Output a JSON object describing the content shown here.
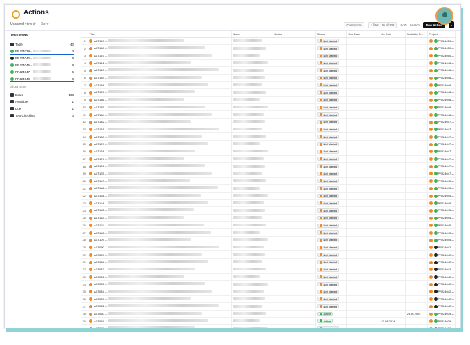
{
  "header": {
    "title": "Actions",
    "view_label": "Unsaved view ⊙",
    "save_label": "Save"
  },
  "toolbar": {
    "customize": "Customize",
    "filter": "1 filter | 40 of 138",
    "sort": "Sort",
    "search": "Search",
    "new_action": "New Action",
    "dropdown": "⌄"
  },
  "sidebar": {
    "heading": "Team views",
    "table": {
      "label": "Table",
      "count": "40"
    },
    "projects": [
      {
        "label": "PRJ24039 -",
        "count": "3",
        "color": "#3fb25a"
      },
      {
        "label": "PRJ24042 -",
        "count": "9",
        "color": "#222222"
      },
      {
        "label": "PRJ24045 -",
        "count": "9",
        "color": "#3fb25a"
      },
      {
        "label": "PRJ24047 -",
        "count": "6",
        "color": "#3fb25a"
      },
      {
        "label": "PRJ24048 -",
        "count": "8",
        "color": "#3fb25a"
      }
    ],
    "show_more": "Show more",
    "views": [
      {
        "label": "Board",
        "count": "138"
      },
      {
        "label": "Available",
        "count": "1"
      },
      {
        "label": "Due",
        "count": "1"
      },
      {
        "label": "Text Checklist",
        "count": "0"
      }
    ]
  },
  "columns": {
    "title": "Title",
    "name": "Name",
    "notes": "Notes",
    "status": "Status",
    "due": "Due Date",
    "do": "Do Date",
    "available": "Available Fr...",
    "project": "Project"
  },
  "rows": [
    {
      "n": "1",
      "id": "ACT159 -/-",
      "status": "Not started",
      "do": "",
      "avail": "",
      "project": "PRJ24050 -/-",
      "pc": "#3fb25a"
    },
    {
      "n": "2",
      "id": "ACT158 -/-",
      "status": "Not started",
      "do": "",
      "avail": "",
      "project": "PRJ24050 -/-",
      "pc": "#3fb25a"
    },
    {
      "n": "3",
      "id": "ACT157 -/-",
      "status": "Not started",
      "do": "",
      "avail": "",
      "project": "PRJ24050 -/-",
      "pc": "#3fb25a"
    },
    {
      "n": "4",
      "id": "ACT141 -/-",
      "status": "Not started",
      "do": "",
      "avail": "",
      "project": "PRJ24048 -/-",
      "pc": "#3fb25a"
    },
    {
      "n": "5",
      "id": "ACT140 -/-",
      "status": "Not started",
      "do": "",
      "avail": "",
      "project": "PRJ24048 -/-",
      "pc": "#3fb25a"
    },
    {
      "n": "6",
      "id": "ACT139 -/-",
      "status": "Not started",
      "do": "",
      "avail": "",
      "project": "PRJ24048 -/-",
      "pc": "#3fb25a"
    },
    {
      "n": "7",
      "id": "ACT138 -/-",
      "status": "Not started",
      "do": "",
      "avail": "",
      "project": "PRJ24048 -/-",
      "pc": "#3fb25a"
    },
    {
      "n": "8",
      "id": "ACT137 -/-",
      "status": "Not started",
      "do": "",
      "avail": "",
      "project": "PRJ24048 -/-",
      "pc": "#3fb25a"
    },
    {
      "n": "9",
      "id": "ACT136 -/-",
      "status": "Not started",
      "do": "",
      "avail": "",
      "project": "PRJ24048 -/-",
      "pc": "#3fb25a"
    },
    {
      "n": "10",
      "id": "ACT135 -/-",
      "status": "Not started",
      "do": "",
      "avail": "",
      "project": "PRJ24048 -/-",
      "pc": "#3fb25a"
    },
    {
      "n": "11",
      "id": "ACT134 -/-",
      "status": "Not started",
      "do": "",
      "avail": "",
      "project": "PRJ24048 -/-",
      "pc": "#3fb25a"
    },
    {
      "n": "12",
      "id": "ACT132 -/-",
      "status": "Not started",
      "do": "",
      "avail": "",
      "project": "PRJ24047 -/-",
      "pc": "#3fb25a"
    },
    {
      "n": "13",
      "id": "ACT131 -/-",
      "status": "Not started",
      "do": "",
      "avail": "",
      "project": "PRJ24047 -/-",
      "pc": "#3fb25a"
    },
    {
      "n": "14",
      "id": "ACT130 -/-",
      "status": "Not started",
      "do": "",
      "avail": "",
      "project": "PRJ24047 -/-",
      "pc": "#3fb25a"
    },
    {
      "n": "15",
      "id": "ACT129 -/-",
      "status": "Not started",
      "do": "",
      "avail": "",
      "project": "PRJ24047 -/-",
      "pc": "#3fb25a"
    },
    {
      "n": "16",
      "id": "ACT128 -/-",
      "status": "Not started",
      "do": "",
      "avail": "",
      "project": "PRJ24047 -/-",
      "pc": "#3fb25a"
    },
    {
      "n": "17",
      "id": "ACT127 -/-",
      "status": "Not started",
      "do": "",
      "avail": "",
      "project": "PRJ24047 -/-",
      "pc": "#3fb25a"
    },
    {
      "n": "18",
      "id": "ACT126 -/-",
      "status": "Not started",
      "do": "",
      "avail": "",
      "project": "PRJ24047 -/-",
      "pc": "#3fb25a"
    },
    {
      "n": "19",
      "id": "ACT125 -/-",
      "status": "Not started",
      "do": "",
      "avail": "",
      "project": "PRJ24047 -/-",
      "pc": "#3fb25a"
    },
    {
      "n": "20",
      "id": "ACT117 -/-",
      "status": "Not started",
      "do": "",
      "avail": "",
      "project": "PRJ24045 -/-",
      "pc": "#3fb25a"
    },
    {
      "n": "21",
      "id": "ACT116 -/-",
      "status": "Not started",
      "do": "",
      "avail": "",
      "project": "PRJ24045 -/-",
      "pc": "#3fb25a"
    },
    {
      "n": "22",
      "id": "ACT115 -/-",
      "status": "Not started",
      "do": "",
      "avail": "",
      "project": "PRJ24045 -/-",
      "pc": "#3fb25a"
    },
    {
      "n": "23",
      "id": "ACT114 -/-",
      "status": "Not started",
      "do": "",
      "avail": "",
      "project": "PRJ24045 -/-",
      "pc": "#3fb25a"
    },
    {
      "n": "24",
      "id": "ACT113 -/-",
      "status": "Not started",
      "do": "",
      "avail": "",
      "project": "PRJ24045 -/-",
      "pc": "#3fb25a"
    },
    {
      "n": "25",
      "id": "ACT112 -/-",
      "status": "Not started",
      "do": "",
      "avail": "",
      "project": "PRJ24045 -/-",
      "pc": "#3fb25a"
    },
    {
      "n": "26",
      "id": "ACT111 -/-",
      "status": "Not started",
      "do": "",
      "avail": "",
      "project": "PRJ24045 -/-",
      "pc": "#3fb25a"
    },
    {
      "n": "27",
      "id": "ACT110 -/-",
      "status": "Not started",
      "do": "",
      "avail": "",
      "project": "PRJ24045 -/-",
      "pc": "#3fb25a"
    },
    {
      "n": "28",
      "id": "ACT109 -/-",
      "status": "Not started",
      "do": "",
      "avail": "",
      "project": "PRJ24045 -/-",
      "pc": "#3fb25a"
    },
    {
      "n": "29",
      "id": "ACT090 -/-",
      "status": "Not started",
      "do": "",
      "avail": "",
      "project": "PRJ24042 -/-",
      "pc": "#222222"
    },
    {
      "n": "30",
      "id": "ACT089 -/-",
      "status": "Not started",
      "do": "",
      "avail": "",
      "project": "PRJ24042 -/-",
      "pc": "#222222"
    },
    {
      "n": "31",
      "id": "ACT088 -/-",
      "status": "Not started",
      "do": "",
      "avail": "",
      "project": "PRJ24042 -/-",
      "pc": "#222222"
    },
    {
      "n": "32",
      "id": "ACT087 -/-",
      "status": "Not started",
      "do": "",
      "avail": "",
      "project": "PRJ24042 -/-",
      "pc": "#222222"
    },
    {
      "n": "33",
      "id": "ACT086 -/-",
      "status": "Not started",
      "do": "",
      "avail": "",
      "project": "PRJ24042 -/-",
      "pc": "#222222"
    },
    {
      "n": "34",
      "id": "ACT085 -/-",
      "status": "Not started",
      "do": "",
      "avail": "",
      "project": "PRJ24042 -/-",
      "pc": "#222222"
    },
    {
      "n": "35",
      "id": "ACT084 -/-",
      "status": "Not started",
      "do": "",
      "avail": "",
      "project": "PRJ24042 -/-",
      "pc": "#222222"
    },
    {
      "n": "36",
      "id": "ACT083 -/-",
      "status": "Not started",
      "do": "",
      "avail": "",
      "project": "PRJ24042 -/-",
      "pc": "#222222"
    },
    {
      "n": "37",
      "id": "ACT082 -/-",
      "status": "Not started",
      "do": "",
      "avail": "",
      "project": "PRJ24042 -/-",
      "pc": "#222222"
    },
    {
      "n": "38",
      "id": "ACT060 -/-",
      "status": "Active",
      "do": "",
      "avail": "23.06.2024",
      "project": "PRJ24039 -/-",
      "pc": "#3fb25a"
    },
    {
      "n": "39",
      "id": "ACT059 -/-",
      "status": "Active",
      "do": "23.08.2024",
      "avail": "",
      "project": "PRJ24039 -/-",
      "pc": "#3fb25a"
    },
    {
      "n": "40",
      "id": "ACT057 -/-",
      "status": "Not started",
      "do": "",
      "avail": "",
      "project": "PRJ24039 -/-",
      "pc": "#3fb25a"
    }
  ]
}
